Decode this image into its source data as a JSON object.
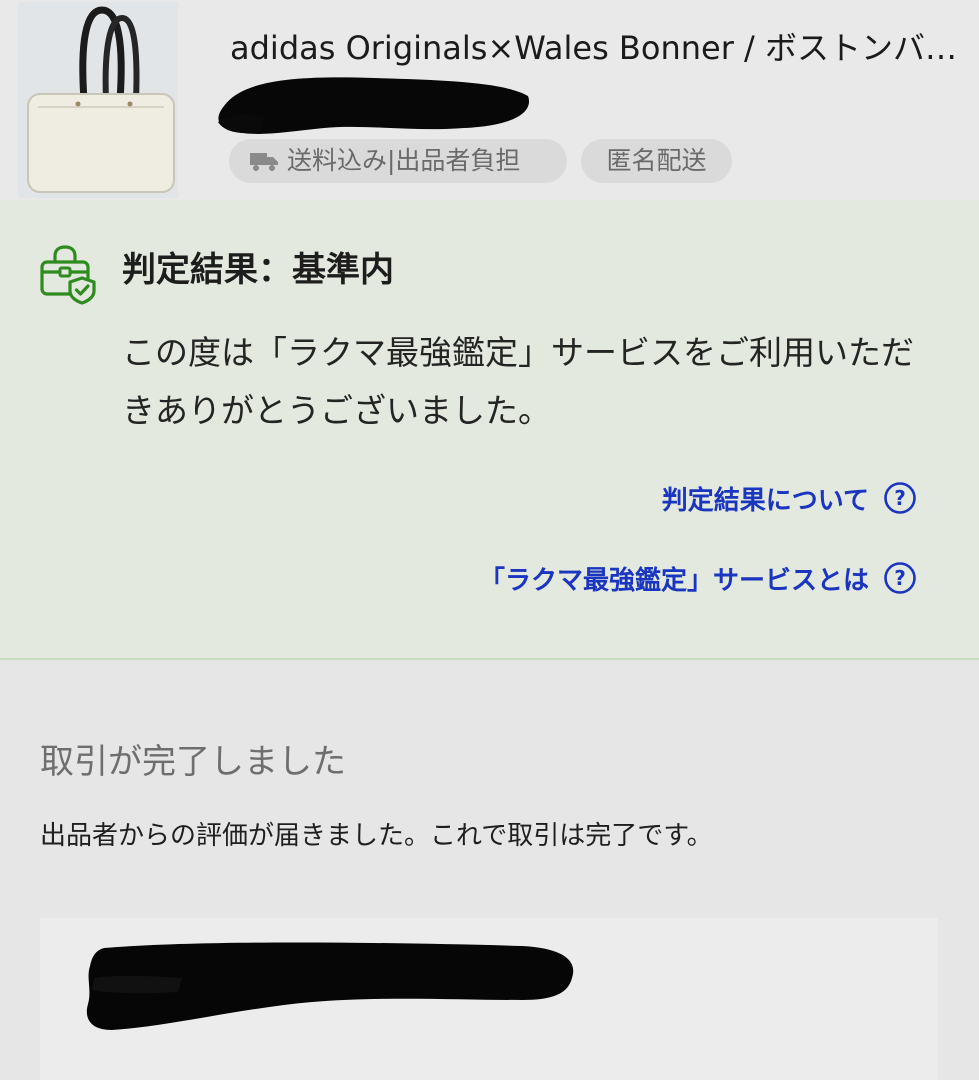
{
  "product": {
    "title": "adidas Originals×Wales Bonner / ボストンバッグ",
    "tags": {
      "shipping": "送料込み|出品者負担",
      "anonymous": "匿名配送"
    }
  },
  "verification": {
    "title": "判定結果：基準内",
    "message": "この度は「ラクマ最強鑑定」サービスをご利用いただきありがとうございました。",
    "links": {
      "about_result": "判定結果について",
      "about_service": "「ラクマ最強鑑定」サービスとは"
    }
  },
  "completion": {
    "heading": "取引が完了しました",
    "message": "出品者からの評価が届きました。これで取引は完了です。"
  },
  "colors": {
    "link": "#1a35c0",
    "verify_icon": "#2e8b1e",
    "verify_background": "#e3e9df",
    "page_background": "#e6e6e6"
  },
  "icons": {
    "verify": "shopping-bag-shield-icon",
    "help": "question-circle-icon",
    "shipping": "truck-icon"
  }
}
